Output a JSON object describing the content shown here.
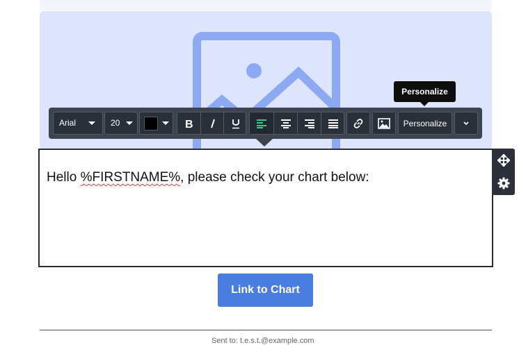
{
  "toolbar": {
    "font_family": "Arial",
    "font_size": "20",
    "text_color": "#000000",
    "personalize_label": "Personalize"
  },
  "tooltip": {
    "text": "Personalize"
  },
  "content": {
    "line_prefix": "Hello ",
    "merge_tag": "%FIRSTNAME%",
    "line_suffix": ", please check your chart below:"
  },
  "cta": {
    "label": "Link to Chart"
  },
  "footer": {
    "sent_to": "Sent to: t.e.s.t.@example.com"
  },
  "colors": {
    "accent": "#4a7de0",
    "image_placeholder_bg": "#dde5fd",
    "image_icon": "#8ea9f3",
    "toolbar_bg": "#3d4450",
    "active_align": "#39c98f"
  },
  "icons": [
    "image-placeholder-icon",
    "bold-icon",
    "italic-icon",
    "underline-icon",
    "align-left-icon",
    "align-center-icon",
    "align-right-icon",
    "align-justify-icon",
    "link-icon",
    "insert-image-icon",
    "chevron-down-icon",
    "move-icon",
    "gear-icon"
  ]
}
